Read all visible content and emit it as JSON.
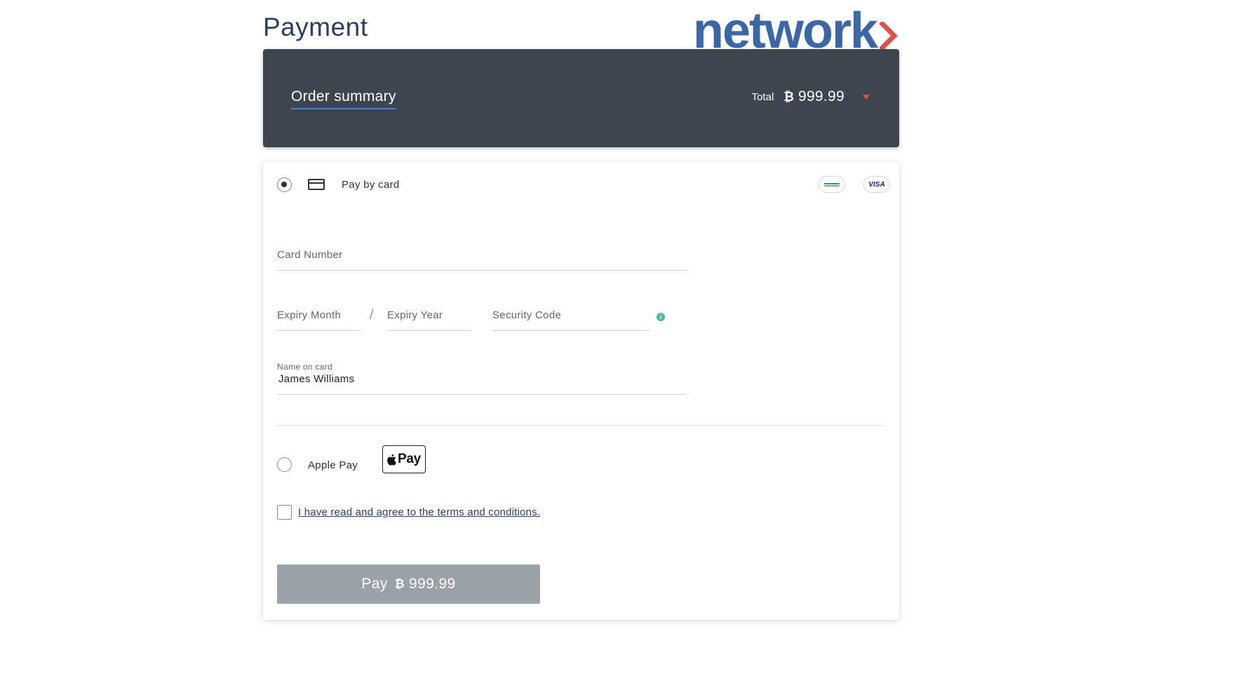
{
  "header": {
    "title": "Payment",
    "logo_text": "network",
    "logo_colors": {
      "text": "#3b67a6",
      "chevron": "#d9534f"
    }
  },
  "summary": {
    "title": "Order summary",
    "total_label": "Total",
    "currency_symbol": "₿",
    "total_amount": "999.99"
  },
  "payment_options": {
    "card": {
      "label": "Pay by card",
      "selected": true,
      "brands": [
        "mada",
        "VISA"
      ]
    },
    "apple_pay": {
      "label": "Apple Pay",
      "badge_text": "Pay",
      "selected": false
    }
  },
  "form": {
    "card_number_placeholder": "Card Number",
    "expiry_month_placeholder": "Expiry Month",
    "expiry_year_placeholder": "Expiry Year",
    "security_code_placeholder": "Security Code",
    "name_label": "Name on card",
    "name_value": "James Williams"
  },
  "terms": {
    "text": "I have read and agree to the terms and conditions.",
    "checked": false
  },
  "pay_button": {
    "label": "Pay",
    "currency_symbol": "₿",
    "amount": "999.99"
  }
}
